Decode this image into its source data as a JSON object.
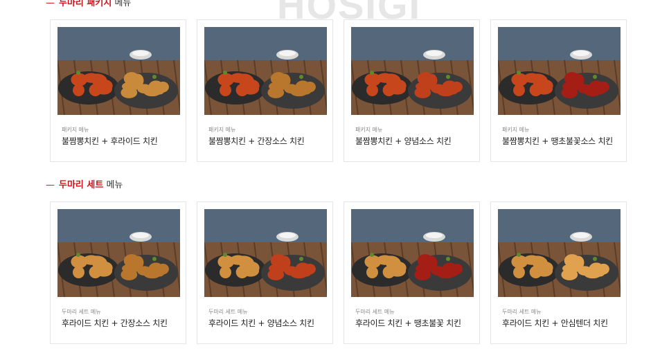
{
  "watermark": "HOSIGI",
  "sections": [
    {
      "title_highlight": "두마리 패키지",
      "title_rest": "메뉴",
      "items": [
        {
          "category": "패키지 메뉴",
          "name": "불짬뽕치킨 + 후라이드 치킨",
          "left": "#c8461c",
          "right": "#c98a3c"
        },
        {
          "category": "패키지 메뉴",
          "name": "불짬뽕치킨 + 간장소스 치킨",
          "left": "#c8461c",
          "right": "#b9772e"
        },
        {
          "category": "패키지 메뉴",
          "name": "불짬뽕치킨 + 양념소스 치킨",
          "left": "#c8461c",
          "right": "#c0401c"
        },
        {
          "category": "패키지 메뉴",
          "name": "불짬뽕치킨 + 땡초불꽃소스 치킨",
          "left": "#c8461c",
          "right": "#a51e16"
        }
      ]
    },
    {
      "title_highlight": "두마리 세트",
      "title_rest": "메뉴",
      "items": [
        {
          "category": "두마리 세트 메뉴",
          "name": "후라이드 치킨 + 간장소스 치킨",
          "left": "#d19040",
          "right": "#b9772e"
        },
        {
          "category": "두마리 세트 메뉴",
          "name": "후라이드 치킨 + 양념소스 치킨",
          "left": "#d19040",
          "right": "#c0401c"
        },
        {
          "category": "두마리 세트 메뉴",
          "name": "후라이드 치킨 + 땡초불꽃 치킨",
          "left": "#d19040",
          "right": "#a51e16"
        },
        {
          "category": "두마리 세트 메뉴",
          "name": "후라이드 치킨 + 안심텐더 치킨",
          "left": "#d19040",
          "right": "#e0a24e"
        }
      ]
    }
  ]
}
